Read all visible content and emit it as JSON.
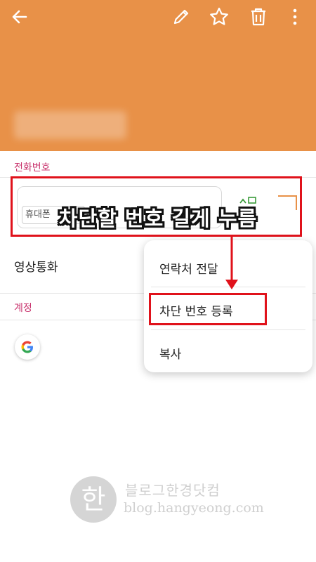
{
  "colors": {
    "header_bg": "#e89148",
    "section_label": "#c8326c",
    "highlight_red": "#e0121b"
  },
  "header": {
    "back_icon": "arrow-left-icon",
    "edit_icon": "pencil-icon",
    "favorite_icon": "star-icon",
    "delete_icon": "trash-icon",
    "more_icon": "more-vertical-icon"
  },
  "sections": {
    "phone_label": "전화번호",
    "account_label": "계정"
  },
  "phone": {
    "type_label": "휴대폰"
  },
  "video_call_label": "영상통화",
  "overlay_caption": "차단할 번호 길게 누름",
  "context_menu": {
    "items": [
      "연락처 전달",
      "차단 번호 등록",
      "복사"
    ]
  },
  "account": {
    "icon": "google-icon"
  },
  "watermark": {
    "title": "블로그한경닷컴",
    "url": "blog.hangyeong.com",
    "logo_char": "한"
  }
}
